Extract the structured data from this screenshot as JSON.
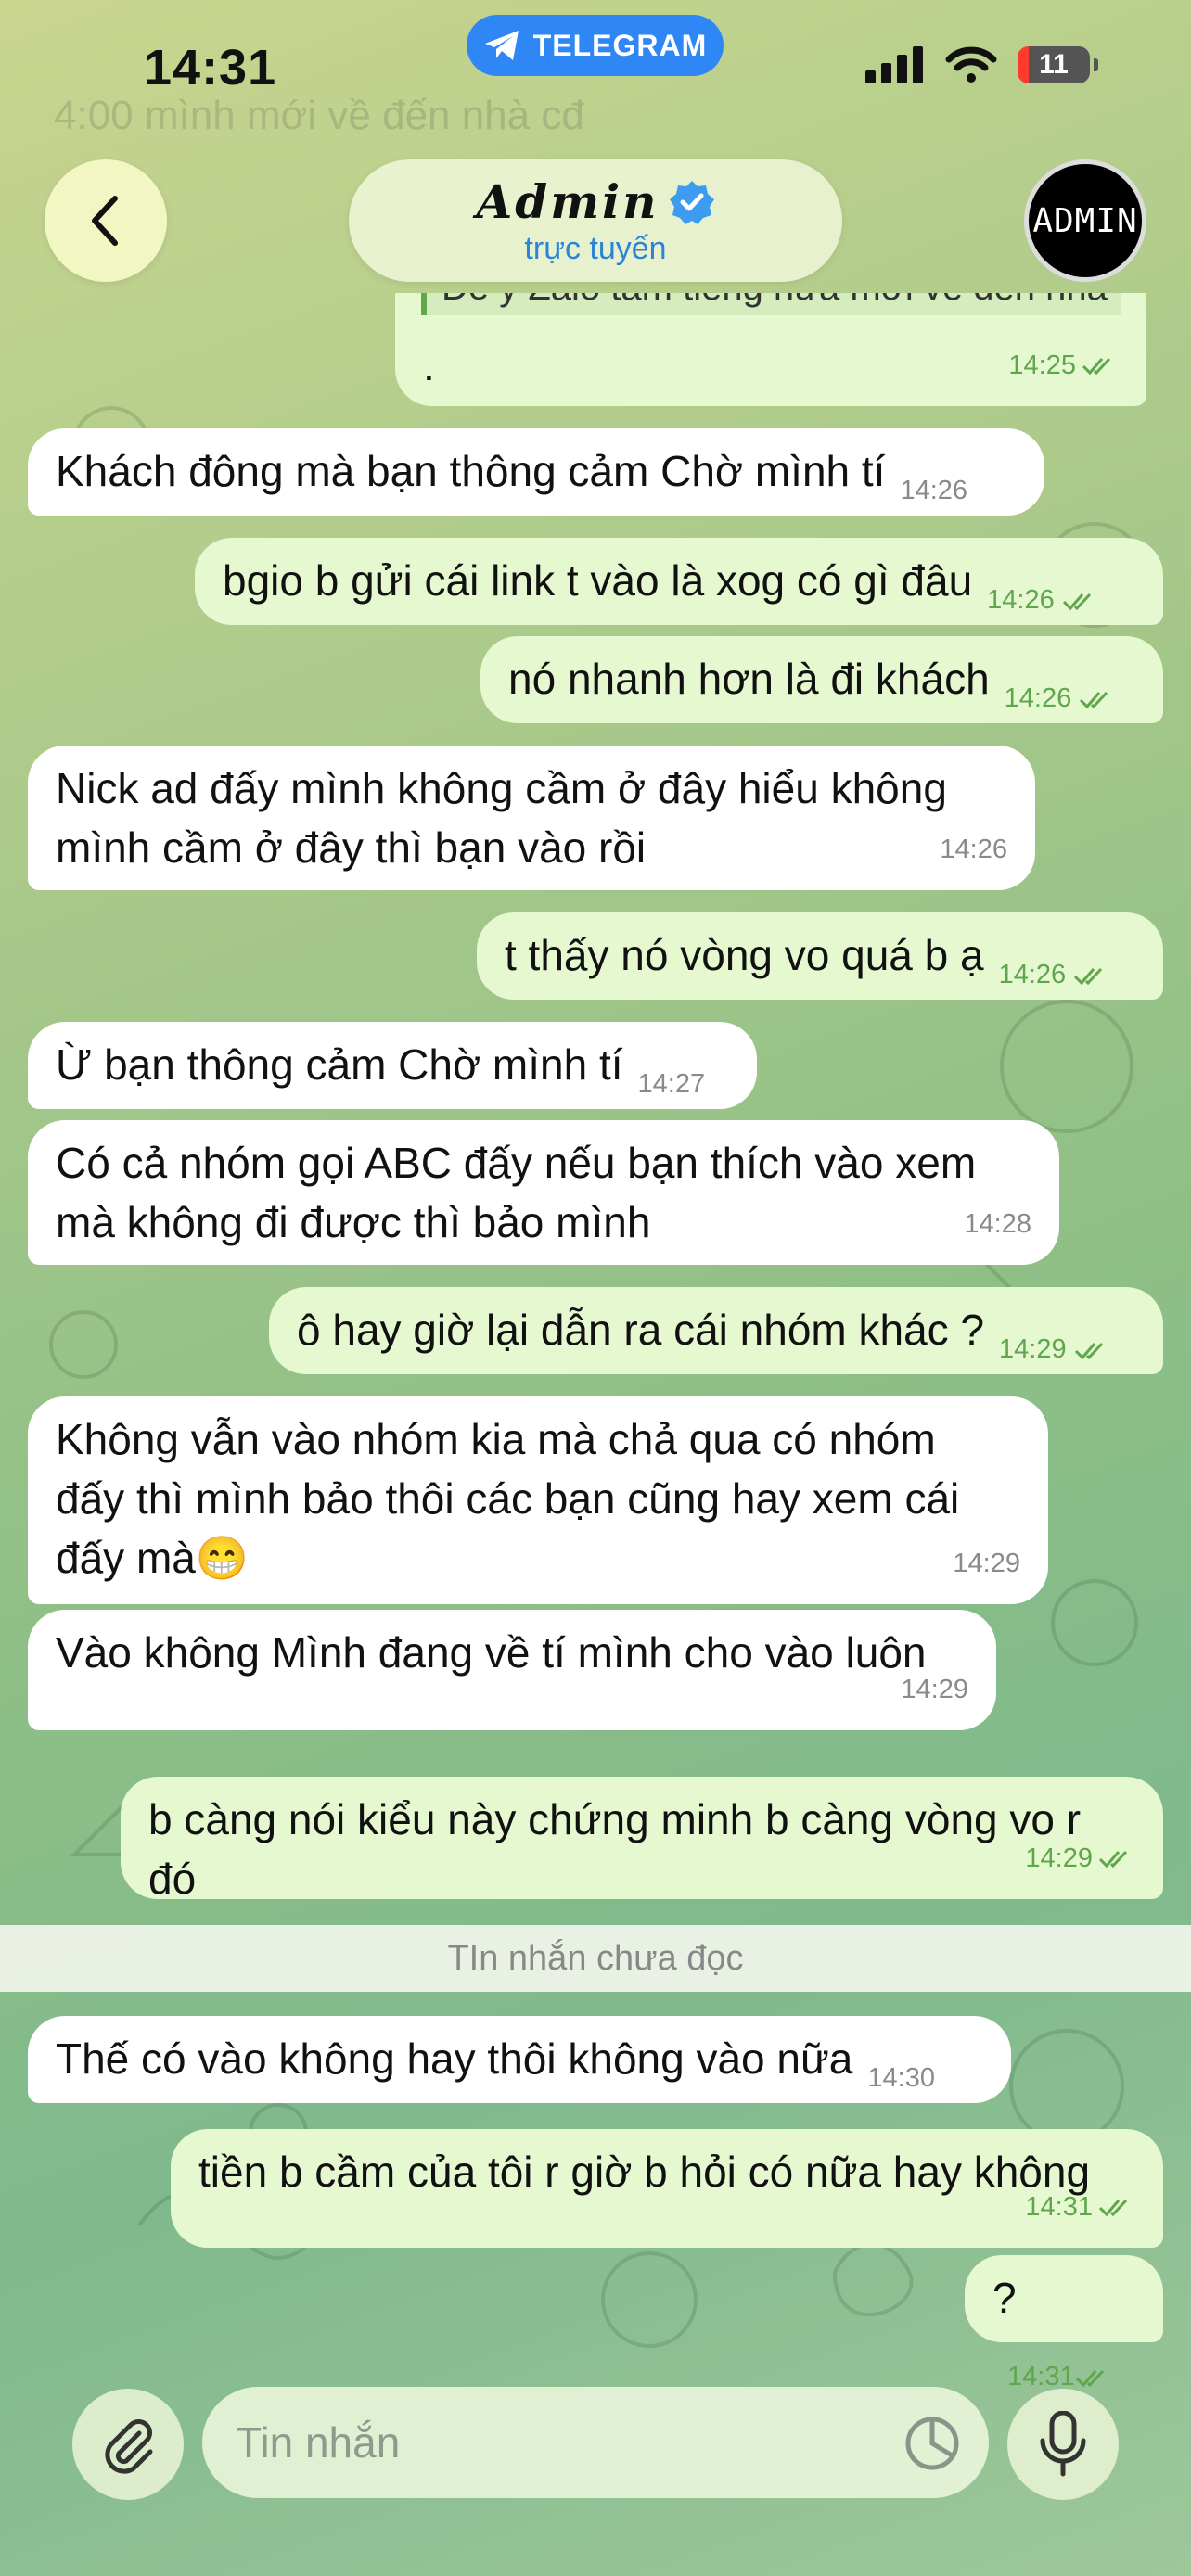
{
  "status_bar": {
    "time": "14:31",
    "app_pill": "TELEGRAM",
    "battery": "11"
  },
  "header": {
    "name": "Admin",
    "status": "trực tuyến",
    "avatar_text": "ADMIN"
  },
  "faded_top_text": "4:00 mình mới về đến nhà cđ",
  "messages": [
    {
      "dir": "out",
      "quote": "Để ý Zalo tầm tiếng nữa mới về đến nha",
      "text": ".",
      "time": "14:25"
    },
    {
      "dir": "in",
      "text": "Khách đông mà bạn thông cảm Chờ mình tí",
      "time": "14:26"
    },
    {
      "dir": "out",
      "text": "bgio b gửi cái link t vào là xog có gì đâu",
      "time": "14:26"
    },
    {
      "dir": "out",
      "text": "nó nhanh hơn là đi khách",
      "time": "14:26"
    },
    {
      "dir": "in",
      "text": "Nick ad đấy mình không cầm ở đây hiểu không mình cầm ở đây thì bạn vào rồi",
      "time": "14:26"
    },
    {
      "dir": "out",
      "text": "t thấy nó vòng vo quá b ạ",
      "time": "14:26"
    },
    {
      "dir": "in",
      "text": "Ừ bạn thông cảm Chờ mình tí",
      "time": "14:27"
    },
    {
      "dir": "in",
      "text": "Có cả nhóm gọi ABC đấy nếu bạn thích vào xem mà không đi được thì bảo mình",
      "time": "14:28"
    },
    {
      "dir": "out",
      "text": "ô hay giờ lại dẫn ra cái nhóm khác ?",
      "time": "14:29"
    },
    {
      "dir": "in",
      "text": "Không vẫn vào nhóm kia mà chả qua có nhóm đấy thì mình bảo thôi các bạn cũng hay xem cái đấy mà😁",
      "time": "14:29"
    },
    {
      "dir": "in",
      "text": "Vào không Mình đang về tí mình cho vào luôn",
      "time": "14:29"
    },
    {
      "dir": "out",
      "text": "b càng nói kiểu này chứng minh b càng vòng vo r đó",
      "time": "14:29"
    },
    {
      "dir": "in",
      "text": "Thế có vào không hay thôi không vào nữa",
      "time": "14:30"
    },
    {
      "dir": "out",
      "text": "tiền b cầm của tôi r giờ b hỏi có nữa hay không",
      "time": "14:31"
    },
    {
      "dir": "out",
      "text": "?",
      "time": "14:31"
    }
  ],
  "unread_divider": "TIn nhắn chưa đọc",
  "composer": {
    "placeholder": "Tin nhắn"
  },
  "colors": {
    "incoming": "#ffffff",
    "outgoing": "#e5f8cf",
    "accent": "#2f86f5",
    "online": "#2b84d6"
  },
  "icons": [
    "back-icon",
    "verified-icon",
    "telegram-icon",
    "attach-icon",
    "sticker-icon",
    "mic-icon",
    "double-check-icon"
  ]
}
